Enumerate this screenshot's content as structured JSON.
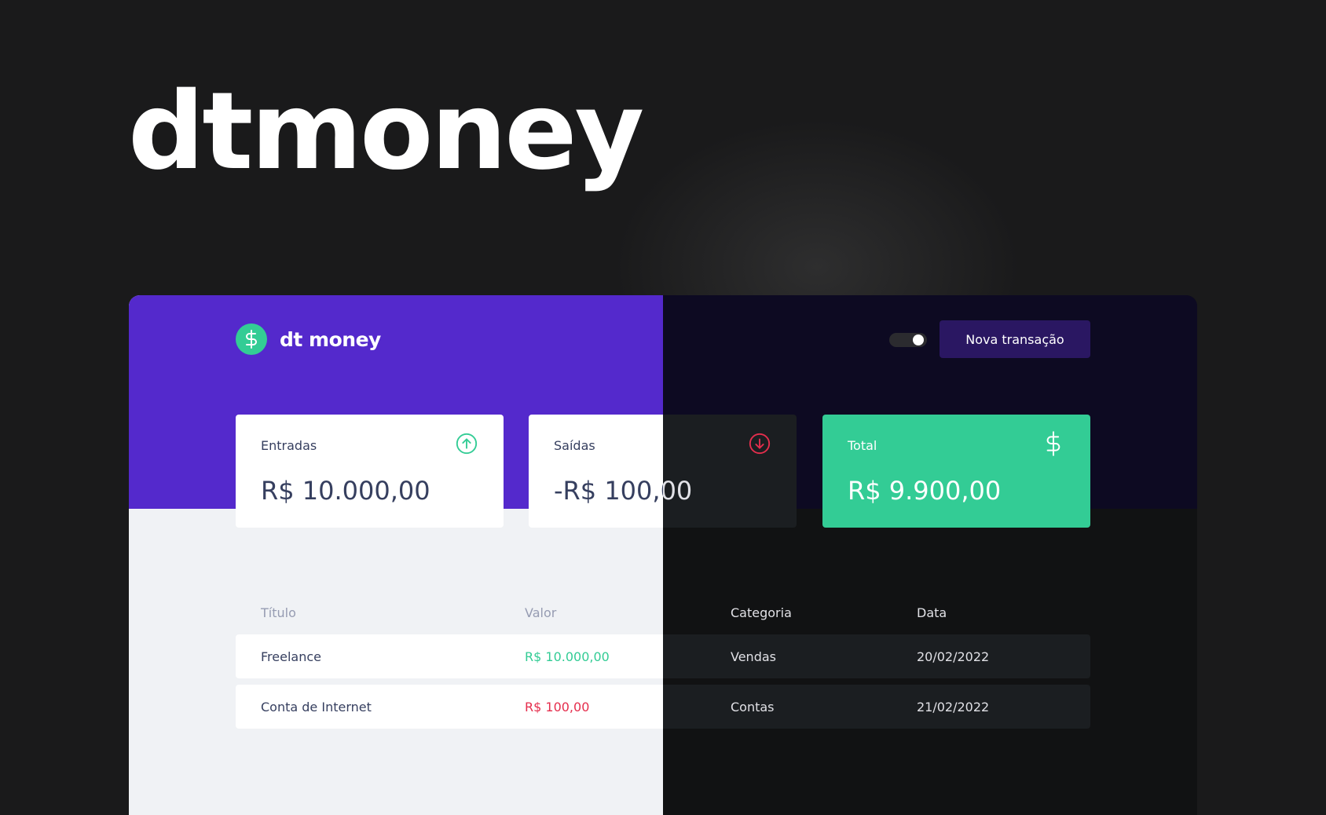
{
  "hero": {
    "title": "dtmoney"
  },
  "app": {
    "logo_text": "dt money",
    "new_transaction_label": "Nova transação",
    "theme_toggle": {
      "state": "on"
    }
  },
  "summary": [
    {
      "label": "Entradas",
      "value": "R$ 10.000,00",
      "icon": "arrow-up-circle-icon"
    },
    {
      "label": "Saídas",
      "value": "-R$ 100,00",
      "icon": "arrow-down-circle-icon"
    },
    {
      "label": "Total",
      "value": "R$ 9.900,00",
      "icon": "dollar-icon"
    }
  ],
  "table": {
    "headers": [
      "Título",
      "Valor",
      "Categoria",
      "Data"
    ],
    "rows": [
      {
        "title": "Freelance",
        "amount": "R$ 10.000,00",
        "type": "deposit",
        "category": "Vendas",
        "date": "20/02/2022"
      },
      {
        "title": "Conta de Internet",
        "amount": "R$ 100,00",
        "type": "withdraw",
        "category": "Contas",
        "date": "21/02/2022"
      }
    ]
  },
  "colors": {
    "brand_purple": "#5429cc",
    "dark_header": "#0d0a22",
    "green": "#33cc95",
    "red": "#e52e4d",
    "light_background": "#f0f2f5",
    "dark_background": "#111213"
  }
}
